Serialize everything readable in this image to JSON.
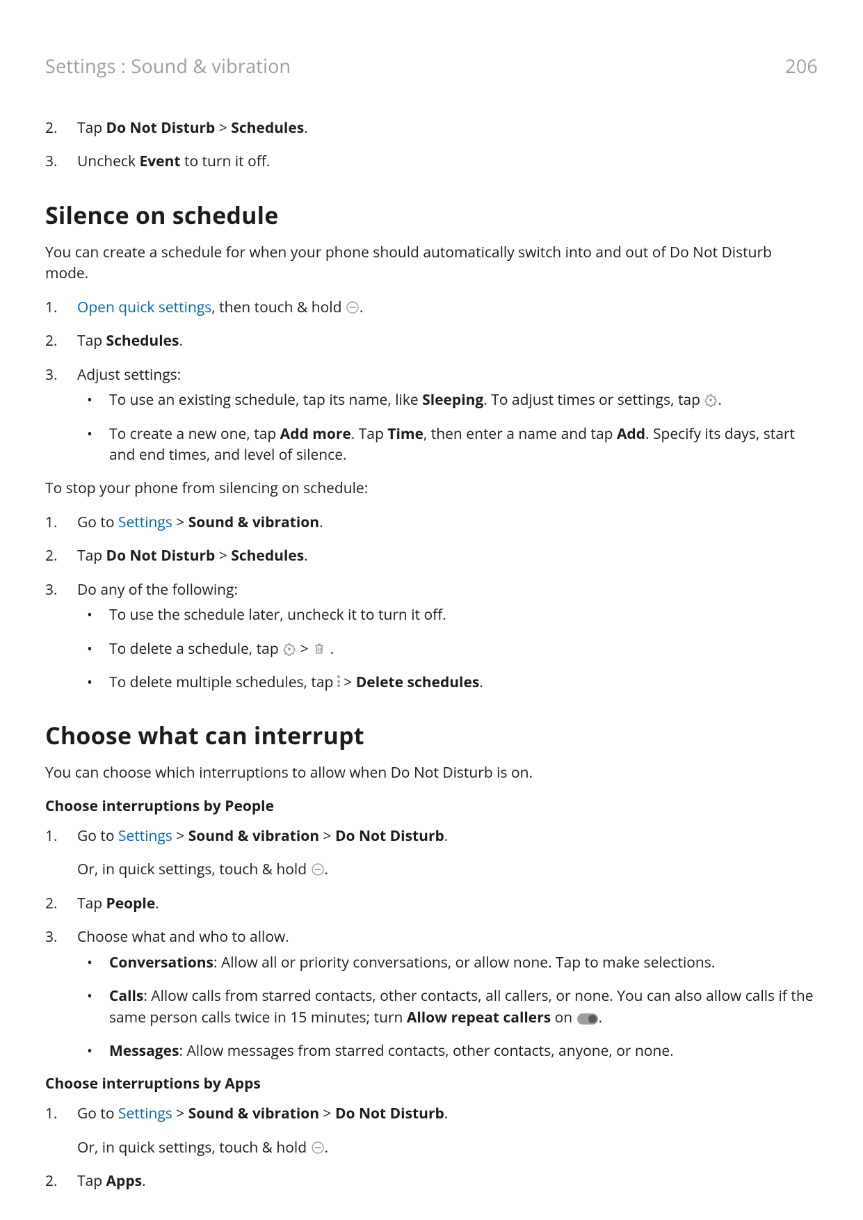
{
  "header": {
    "breadcrumb": "Settings : Sound & vibration",
    "page_number": "206"
  },
  "intro_steps": {
    "s2": {
      "num": "2",
      "pre": "Tap ",
      "b1": "Do Not Disturb",
      "mid": " > ",
      "b2": "Schedules",
      "post": "."
    },
    "s3": {
      "num": "3",
      "pre": "Uncheck ",
      "b1": "Event",
      "post": " to turn it off."
    }
  },
  "silence": {
    "heading": "Silence on schedule",
    "intro": "You can create a schedule for when your phone should automatically switch into and out of Do Not Disturb mode.",
    "step1": {
      "num": "1",
      "link": "Open quick settings",
      "post": ", then touch & hold "
    },
    "step2": {
      "num": "2",
      "pre": "Tap ",
      "b1": "Schedules",
      "post": "."
    },
    "step3": {
      "num": "3",
      "text": "Adjust settings:",
      "b1_pre": "To use an existing schedule, tap its name, like ",
      "b1_bold": "Sleeping",
      "b1_mid": ". To adjust times or settings, tap ",
      "b2_pre": "To create a new one, tap ",
      "b2_bold1": "Add more",
      "b2_mid1": ". Tap ",
      "b2_bold2": "Time",
      "b2_mid2": ", then enter a name and tap ",
      "b2_bold3": "Add",
      "b2_post": ". Specify its days, start and end times, and level of silence."
    },
    "stop_intro": "To stop your phone from silencing on schedule:",
    "stop1": {
      "num": "1",
      "pre": "Go to ",
      "link": "Settings",
      "mid": " > ",
      "b1": "Sound & vibration",
      "post": "."
    },
    "stop2": {
      "num": "2",
      "pre": "Tap ",
      "b1": "Do Not Disturb",
      "mid": " > ",
      "b2": "Schedules",
      "post": "."
    },
    "stop3": {
      "num": "3",
      "text": "Do any of the following:",
      "b1": "To use the schedule later, uncheck it to turn it off.",
      "b2_pre": "To delete a schedule, tap ",
      "b3_pre": "To delete multiple schedules, tap ",
      "b3_mid": " > ",
      "b3_bold": "Delete schedules",
      "b3_post": "."
    }
  },
  "choose": {
    "heading": "Choose what can interrupt",
    "intro": "You can choose which interruptions to allow when Do Not Disturb is on.",
    "people_title": "Choose interruptions by People",
    "p_step1": {
      "num": "1",
      "pre": "Go to ",
      "link": "Settings",
      "mid1": " > ",
      "b1": "Sound & vibration",
      "mid2": " > ",
      "b2": "Do Not Disturb",
      "post": ".",
      "alt_pre": "Or, in quick settings, touch & hold "
    },
    "p_step2": {
      "num": "2",
      "pre": "Tap ",
      "b1": "People",
      "post": "."
    },
    "p_step3": {
      "num": "3",
      "text": "Choose what and who to allow.",
      "conv_b": "Conversations",
      "conv": ": Allow all or priority conversations, or allow none. Tap to make selections.",
      "calls_b": "Calls",
      "calls_pre": ": Allow calls from starred contacts, other contacts, all callers, or none. You can also allow calls if the same person calls twice in 15 minutes; turn ",
      "calls_bold": "Allow repeat callers",
      "calls_mid": " on ",
      "msg_b": "Messages",
      "msg": ": Allow messages from starred contacts, other contacts, anyone, or none."
    },
    "apps_title": "Choose interruptions by Apps",
    "a_step1": {
      "num": "1",
      "pre": "Go to ",
      "link": "Settings",
      "mid1": " > ",
      "b1": "Sound & vibration",
      "mid2": " > ",
      "b2": "Do Not Disturb",
      "post": ".",
      "alt_pre": "Or, in quick settings, touch & hold "
    },
    "a_step2": {
      "num": "2",
      "pre": "Tap ",
      "b1": "Apps",
      "post": "."
    }
  }
}
